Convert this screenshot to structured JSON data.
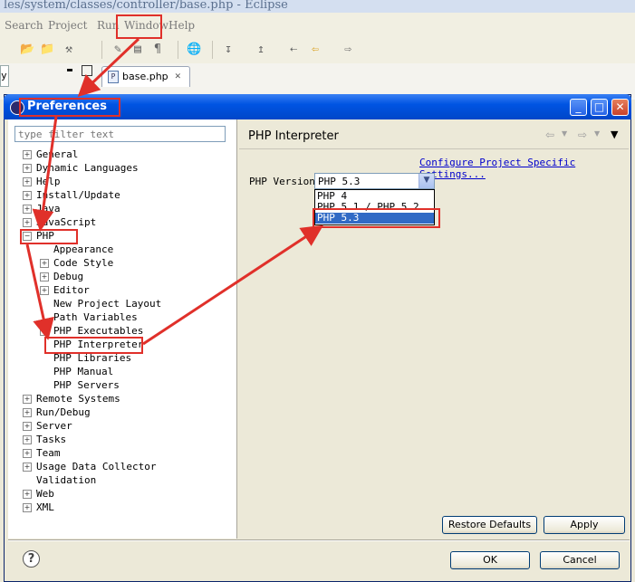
{
  "window": {
    "title": "les/system/classes/controller/base.php - Eclipse"
  },
  "menubar": [
    "Search",
    "Project",
    "Run",
    "Window",
    "Help"
  ],
  "editor": {
    "tab_label": "base.php",
    "left_stub": "y"
  },
  "dialog": {
    "title": "Preferences",
    "filter_placeholder": "type filter text",
    "tree": [
      {
        "label": "General",
        "expandable": true
      },
      {
        "label": "Dynamic Languages",
        "expandable": true
      },
      {
        "label": "Help",
        "expandable": true
      },
      {
        "label": "Install/Update",
        "expandable": true
      },
      {
        "label": "Java",
        "expandable": true
      },
      {
        "label": "JavaScript",
        "expandable": true
      },
      {
        "label": "PHP",
        "expanded": true
      },
      {
        "label": "Appearance",
        "child": true
      },
      {
        "label": "Code Style",
        "child": true,
        "expandable": true
      },
      {
        "label": "Debug",
        "child": true,
        "expandable": true
      },
      {
        "label": "Editor",
        "child": true,
        "expandable": true
      },
      {
        "label": "New Project Layout",
        "child": true
      },
      {
        "label": "Path Variables",
        "child": true
      },
      {
        "label": "PHP Executables",
        "child": true,
        "expandable": true
      },
      {
        "label": "PHP Interpreter",
        "child": true,
        "selected": true
      },
      {
        "label": "PHP Libraries",
        "child": true
      },
      {
        "label": "PHP Manual",
        "child": true
      },
      {
        "label": "PHP Servers",
        "child": true
      },
      {
        "label": "Remote Systems",
        "expandable": true
      },
      {
        "label": "Run/Debug",
        "expandable": true
      },
      {
        "label": "Server",
        "expandable": true
      },
      {
        "label": "Tasks",
        "expandable": true
      },
      {
        "label": "Team",
        "expandable": true
      },
      {
        "label": "Usage Data Collector",
        "expandable": true
      },
      {
        "label": "Validation"
      },
      {
        "label": "Web",
        "expandable": true
      },
      {
        "label": "XML",
        "expandable": true
      }
    ],
    "page_title": "PHP Interpreter",
    "configure_link": "Configure Project Specific Settings...",
    "php_version_label": "PHP Version:",
    "php_version_value": "PHP 5.3",
    "php_version_options": [
      "PHP 4",
      "PHP 5.1 / PHP 5.2",
      "PHP 5.3"
    ],
    "buttons": {
      "restore_defaults": "Restore Defaults",
      "apply": "Apply",
      "ok": "OK",
      "cancel": "Cancel"
    },
    "help_glyph": "?"
  },
  "colors": {
    "annotation": "#e0302a",
    "highlight": "#316ac5",
    "titlebar": "#0054e3"
  }
}
